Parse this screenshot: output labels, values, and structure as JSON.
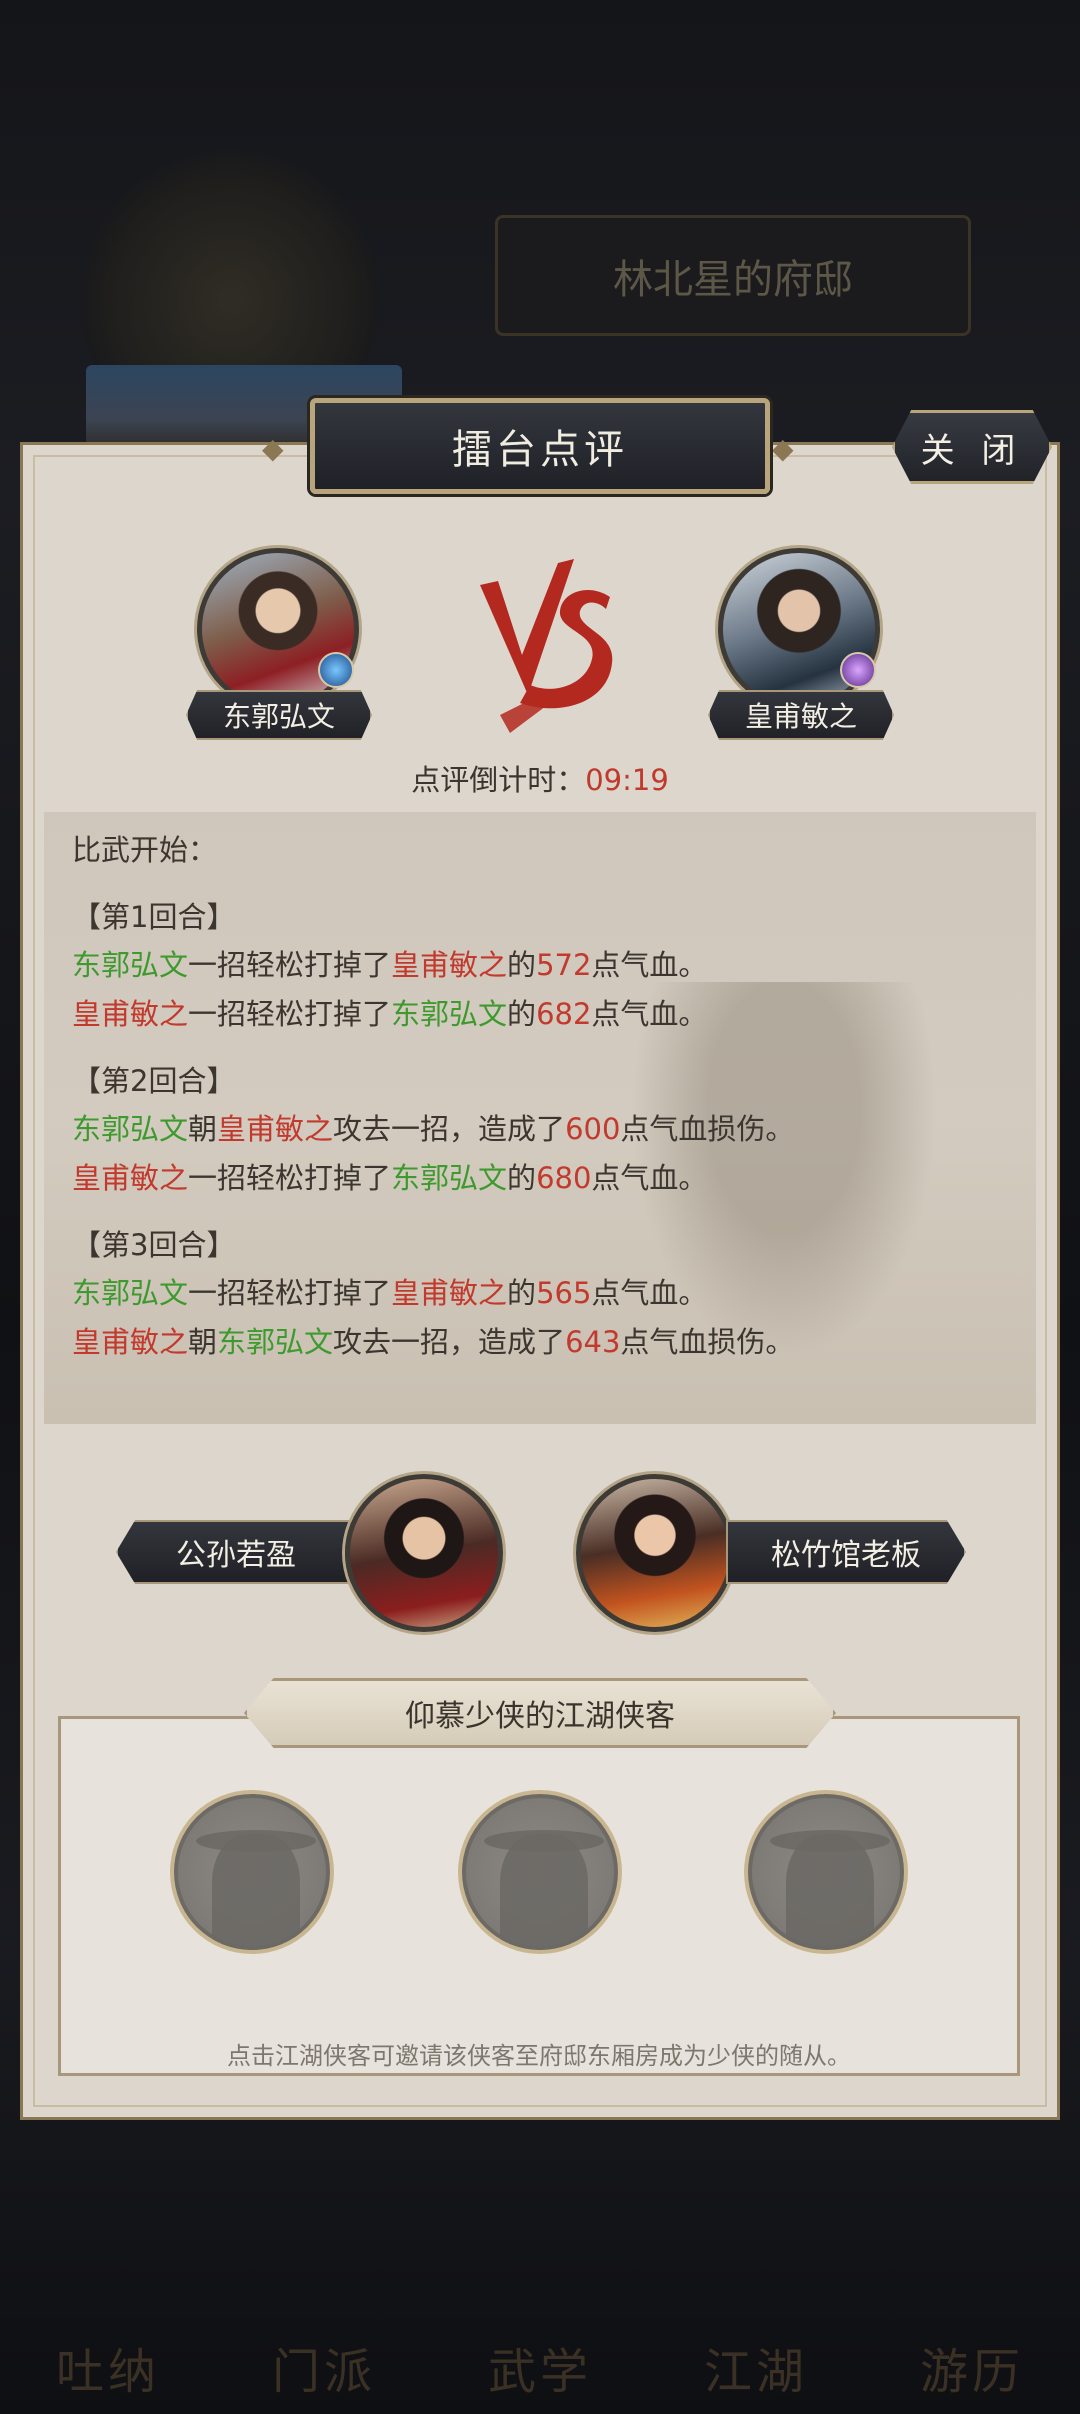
{
  "background": {
    "title": "林北星的府邸",
    "nav": [
      "吐纳",
      "门派",
      "武学",
      "江湖",
      "游历"
    ]
  },
  "dialog": {
    "title": "擂台点评",
    "close_label": "关 闭",
    "fighter_a": "东郭弘文",
    "fighter_b": "皇甫敏之",
    "countdown_label": "点评倒计时：",
    "countdown_time": "09:19",
    "log": {
      "intro": "比武开始：",
      "rounds": [
        {
          "header": "【第1回合】",
          "lines": [
            {
              "actor": "东郭弘文",
              "verb": "一招轻松打掉了",
              "target": "皇甫敏之",
              "pre": "的",
              "value": "572",
              "post": "点气血。"
            },
            {
              "actor": "皇甫敏之",
              "verb": "一招轻松打掉了",
              "target": "东郭弘文",
              "pre": "的",
              "value": "682",
              "post": "点气血。"
            }
          ]
        },
        {
          "header": "【第2回合】",
          "lines": [
            {
              "actor": "东郭弘文",
              "verb": "朝",
              "target": "皇甫敏之",
              "pre": "攻去一招，造成了",
              "value": "600",
              "post": "点气血损伤。"
            },
            {
              "actor": "皇甫敏之",
              "verb": "一招轻松打掉了",
              "target": "东郭弘文",
              "pre": "的",
              "value": "680",
              "post": "点气血。"
            }
          ]
        },
        {
          "header": "【第3回合】",
          "lines": [
            {
              "actor": "东郭弘文",
              "verb": "一招轻松打掉了",
              "target": "皇甫敏之",
              "pre": "的",
              "value": "565",
              "post": "点气血。"
            },
            {
              "actor": "皇甫敏之",
              "verb": "朝",
              "target": "东郭弘文",
              "pre": "攻去一招，造成了",
              "value": "643",
              "post": "点气血损伤。"
            }
          ]
        }
      ]
    },
    "guest_a": "公孙若盈",
    "guest_b": "松竹馆老板",
    "followers_title": "仰慕少侠的江湖侠客",
    "followers_hint": "点击江湖侠客可邀请该侠客至府邸东厢房成为少侠的随从。"
  },
  "colors": {
    "fighter_a": "#3e9a2e",
    "fighter_b": "#c23a2d",
    "number": "#c23a2d",
    "vs": "#b4291f",
    "frame_gold": "#b9a57c"
  }
}
